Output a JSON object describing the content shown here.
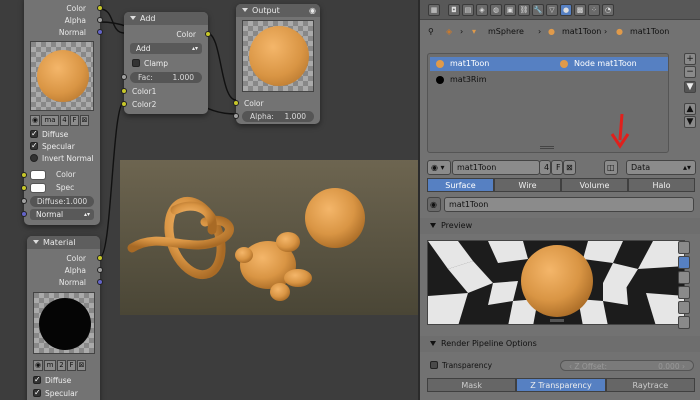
{
  "node_editor": {
    "material_node_top": {
      "outputs": [
        "Color",
        "Alpha",
        "Normal"
      ],
      "datablock_bar": {
        "name": "ma",
        "users": "4",
        "fake": "F"
      },
      "checkboxes": [
        {
          "label": "Diffuse",
          "checked": true
        },
        {
          "label": "Specular",
          "checked": true
        },
        {
          "label": "Invert Normal",
          "checked": false
        }
      ],
      "inputs": {
        "color": "Color",
        "spec": "Spec"
      },
      "diffuse_field": "Diffuse:1.000",
      "normal_dropdown": "Normal"
    },
    "add_node": {
      "title": "Add",
      "output": "Color",
      "mode": "Add",
      "clamp_label": "Clamp",
      "fac_label": "Fac:",
      "fac_value": "1.000",
      "inputs": [
        "Color1",
        "Color2"
      ]
    },
    "output_node": {
      "title": "Output",
      "inputs": [
        "Color",
        "Alpha:"
      ],
      "alpha_value": "1.000"
    },
    "material_node_bottom": {
      "title": "Material",
      "outputs": [
        "Color",
        "Alpha",
        "Normal"
      ],
      "datablock_bar": {
        "name": "m",
        "users": "2",
        "fake": "F"
      },
      "checkboxes": [
        {
          "label": "Diffuse",
          "checked": true
        },
        {
          "label": "Specular",
          "checked": true
        }
      ]
    }
  },
  "properties": {
    "breadcrumb": {
      "object": "mSphere",
      "material": "mat1Toon",
      "node_material": "mat1Toon"
    },
    "slots": [
      {
        "name": "mat1Toon",
        "node": "Node mat1Toon",
        "color": "#e09a4a",
        "node_color": "#e09a4a",
        "selected": true
      },
      {
        "name": "mat3Rim",
        "color": "#000000",
        "selected": false
      }
    ],
    "material_field": {
      "name": "mat1Toon",
      "users": "4",
      "fake": "F"
    },
    "link_dropdown": "Data",
    "tabs": [
      {
        "label": "Surface",
        "active": true
      },
      {
        "label": "Wire",
        "active": false
      },
      {
        "label": "Volume",
        "active": false
      },
      {
        "label": "Halo",
        "active": false
      }
    ],
    "node_material_field": "mat1Toon",
    "preview_title": "Preview",
    "render_pipeline_title": "Render Pipeline Options",
    "transparency_label": "Transparency",
    "z_offset_label": "Z Offset:",
    "z_offset_value": "0.000",
    "bottom_tabs": [
      {
        "label": "Mask",
        "active": false
      },
      {
        "label": "Z Transparency",
        "active": true
      },
      {
        "label": "Raytrace",
        "active": false
      }
    ]
  },
  "colors": {
    "accent": "#5680c2",
    "material_orange": "#e09a4a",
    "arrow_red": "#e0201c"
  }
}
